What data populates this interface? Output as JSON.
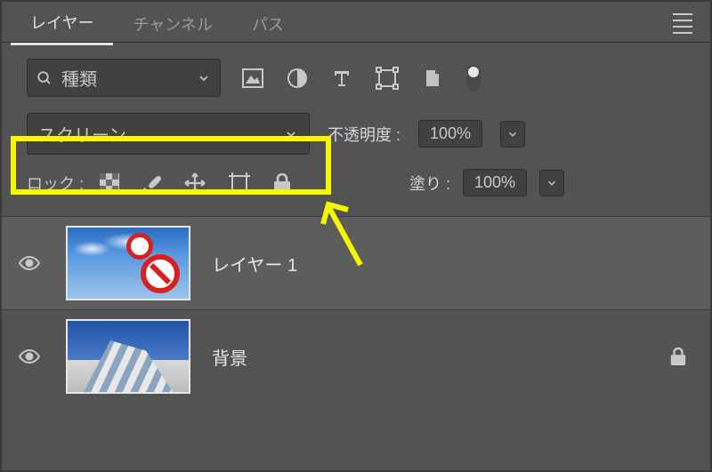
{
  "tabs": {
    "layers": "レイヤー",
    "channels": "チャンネル",
    "paths": "パス"
  },
  "filter": {
    "label": "種類"
  },
  "blend": {
    "mode": "スクリーン"
  },
  "opacity": {
    "label": "不透明度 :",
    "value": "100%"
  },
  "fill": {
    "label": "塗り :",
    "value": "100%"
  },
  "lock": {
    "label": "ロック :"
  },
  "layers_list": [
    {
      "name": "レイヤー 1",
      "locked": false
    },
    {
      "name": "背景",
      "locked": true
    }
  ]
}
